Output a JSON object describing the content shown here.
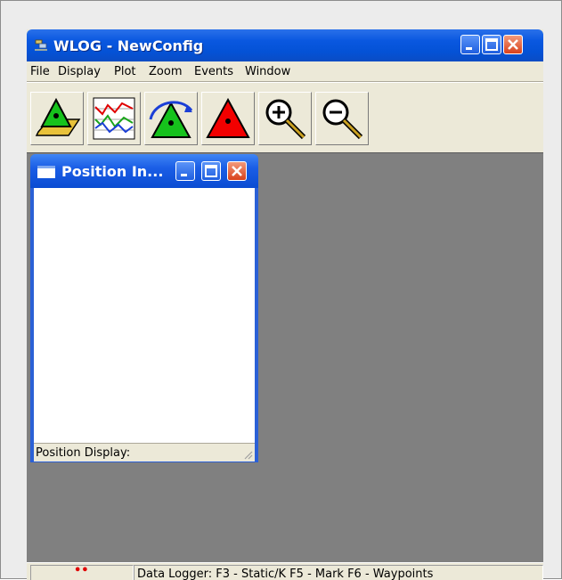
{
  "window": {
    "title": "WLOG - NewConfig",
    "icon": "satellite-app-icon",
    "controls": [
      "minimize",
      "maximize",
      "close"
    ]
  },
  "menu": [
    "File",
    "Display",
    "Plot",
    "Zoom",
    "Events",
    "Window"
  ],
  "toolbar": [
    {
      "icon": "open-config-icon"
    },
    {
      "icon": "plot-chart-icon"
    },
    {
      "icon": "green-triangle-arrow-icon"
    },
    {
      "icon": "red-triangle-icon"
    },
    {
      "icon": "zoom-in-icon"
    },
    {
      "icon": "zoom-out-icon"
    }
  ],
  "child_window": {
    "title": "Position In...",
    "status_text": "Position Display:"
  },
  "statusbar": {
    "indicator": "••",
    "text": "Data Logger:  F3 - Static/K  F5 - Mark  F6 - Waypoints"
  },
  "colors": {
    "titlebar": "#0452d6",
    "mdi_background": "#808080",
    "indicator": "#e00000"
  }
}
